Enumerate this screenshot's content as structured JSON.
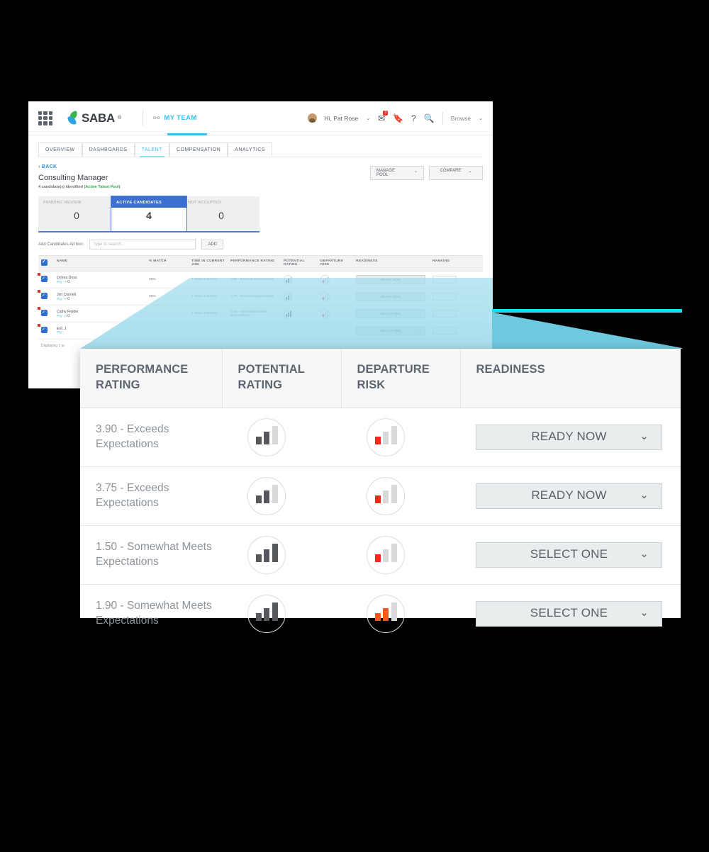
{
  "app": {
    "logo_text": "SABA",
    "logo_tm": "®",
    "grid_icon": "apps-grid-icon",
    "myteam_label": "MY TEAM",
    "myteam_icon": "org-chart-icon",
    "user_greeting": "Hi, Pat Rose",
    "mail_icon": "mail-icon",
    "mail_badge": "3",
    "bookmark_icon": "bookmark-icon",
    "help_icon": "help-icon",
    "search_icon": "search-icon",
    "browse_label": "Browse",
    "caret_icon": "chevron-down-icon"
  },
  "tabs": [
    {
      "label": "OVERVIEW",
      "active": false
    },
    {
      "label": "DASHBOARDS",
      "active": false
    },
    {
      "label": "TALENT",
      "active": true
    },
    {
      "label": "COMPENSATION",
      "active": false
    },
    {
      "label": "ANALYTICS",
      "active": false
    }
  ],
  "page": {
    "back_label": "‹ BACK",
    "title": "Consulting Manager",
    "subtitle_prefix": "4 candidate(s) identified (",
    "subtitle_pool": "Active Talent Pool",
    "subtitle_suffix": ")",
    "manage_pool_label": "MANAGE POOL",
    "compare_label": "COMPARE"
  },
  "stats": [
    {
      "label": "PENDING REVIEW",
      "value": "0",
      "active": false
    },
    {
      "label": "ACTIVE CANDIDATES",
      "value": "4",
      "active": true
    },
    {
      "label": "NOT ACCEPTED",
      "value": "0",
      "active": false
    }
  ],
  "adhoc": {
    "label": "Add Candidates Ad hoc:",
    "placeholder": "Type to search...",
    "add_label": "ADD",
    "search_icon": "search-icon"
  },
  "bg_table": {
    "columns": [
      "NAME",
      "% MATCH",
      "TIME IN CURRENT JOB",
      "PERFORMANCE RATING",
      "POTENTIAL RATING",
      "DEPARTURE RISK",
      "READINESS",
      "RANKING"
    ],
    "rows": [
      {
        "name": "Donna Doss",
        "pq": "PQ - 0",
        "badge": "0",
        "match": "29%",
        "tenure": "1 Years 1 Months",
        "performance": "3.90 - Exceeds Expectations",
        "readiness": "READY NOW"
      },
      {
        "name": "Jim Connell",
        "pq": "PQ - 0",
        "badge": "0",
        "match": "29%",
        "tenure": "1 Years 1 Months",
        "performance": "3.75 - Exceeds Expectations",
        "readiness": "READY NOW"
      },
      {
        "name": "Cathy Fielder",
        "pq": "PQ - 0",
        "badge": "0",
        "match": "",
        "tenure": "2 Years 4 Months",
        "performance": "1.50 - Somewhat Meets Expectations",
        "readiness": "SELECT ONE"
      },
      {
        "name": "Eric J.",
        "pq": "PQ -",
        "badge": "",
        "match": "",
        "tenure": "",
        "performance": "",
        "readiness": "SELECT ONE"
      }
    ],
    "footer": "Displaying 1 to"
  },
  "zoom_table": {
    "columns": [
      {
        "label": "PERFORMANCE RATING"
      },
      {
        "label": "POTENTIAL RATING"
      },
      {
        "label": "DEPARTURE RISK"
      },
      {
        "label": "READINESS"
      }
    ],
    "rows": [
      {
        "performance": "3.90 - Exceeds Expectations",
        "potential_icon": "bar-rating-icon",
        "potential_filled": 2,
        "departure_icon": "bar-risk-icon",
        "departure_filled": 1,
        "departure_color": "#ee2b1c",
        "readiness": "READY NOW"
      },
      {
        "performance": "3.75 - Exceeds Expectations",
        "potential_icon": "bar-rating-icon",
        "potential_filled": 2,
        "departure_icon": "bar-risk-icon",
        "departure_filled": 1,
        "departure_color": "#ee2b1c",
        "readiness": "READY NOW"
      },
      {
        "performance": "1.50 - Somewhat Meets Expectations",
        "potential_icon": "bar-rating-icon",
        "potential_filled": 3,
        "departure_icon": "bar-risk-icon",
        "departure_filled": 1,
        "departure_color": "#ee2b1c",
        "readiness": "SELECT ONE"
      },
      {
        "performance": "1.90 - Somewhat Meets Expectations",
        "potential_icon": "bar-rating-icon",
        "potential_filled": 3,
        "departure_icon": "bar-risk-icon",
        "departure_filled": 2,
        "departure_color": "#f4591f",
        "readiness": "SELECT ONE"
      }
    ],
    "chevron_icon": "chevron-down-icon"
  },
  "colors": {
    "accent_blue": "#38bdf0",
    "beam_cyan": "#5ec3dc",
    "beam_edge": "#00e5ff",
    "brand_green": "#3cb44a",
    "brand_blue": "#2ea3dc",
    "risk_red": "#ee2b1c",
    "risk_orange": "#f4591f",
    "bar_dark": "#55595e",
    "bar_light": "#d9d9d9",
    "active_stat": "#3c6fd0"
  }
}
